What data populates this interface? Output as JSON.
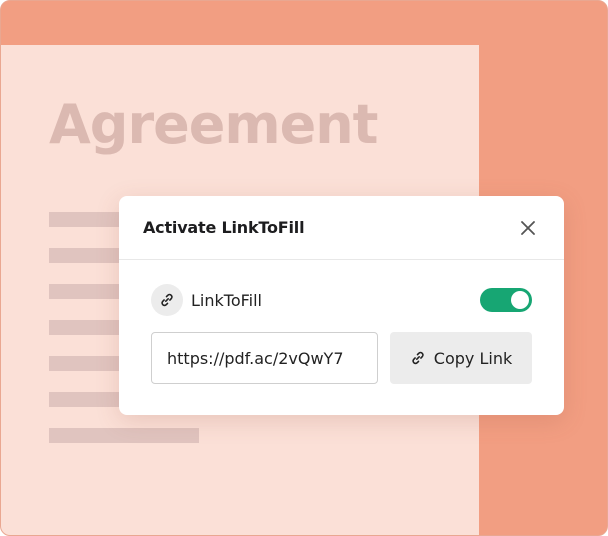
{
  "document": {
    "title": "Agreement"
  },
  "modal": {
    "title": "Activate LinkToFill",
    "close_icon": "close-icon",
    "toggle": {
      "label": "LinkToFill",
      "icon": "link-icon",
      "enabled": true,
      "on_color": "#17a673"
    },
    "url_field": {
      "value": "https://pdf.ac/2vQwY7"
    },
    "copy_button": {
      "label": "Copy Link",
      "icon": "link-icon"
    }
  },
  "colors": {
    "background_accent": "#f29e82",
    "document_page": "#fbe0d7",
    "placeholder_lines": "#e0c4bf"
  }
}
